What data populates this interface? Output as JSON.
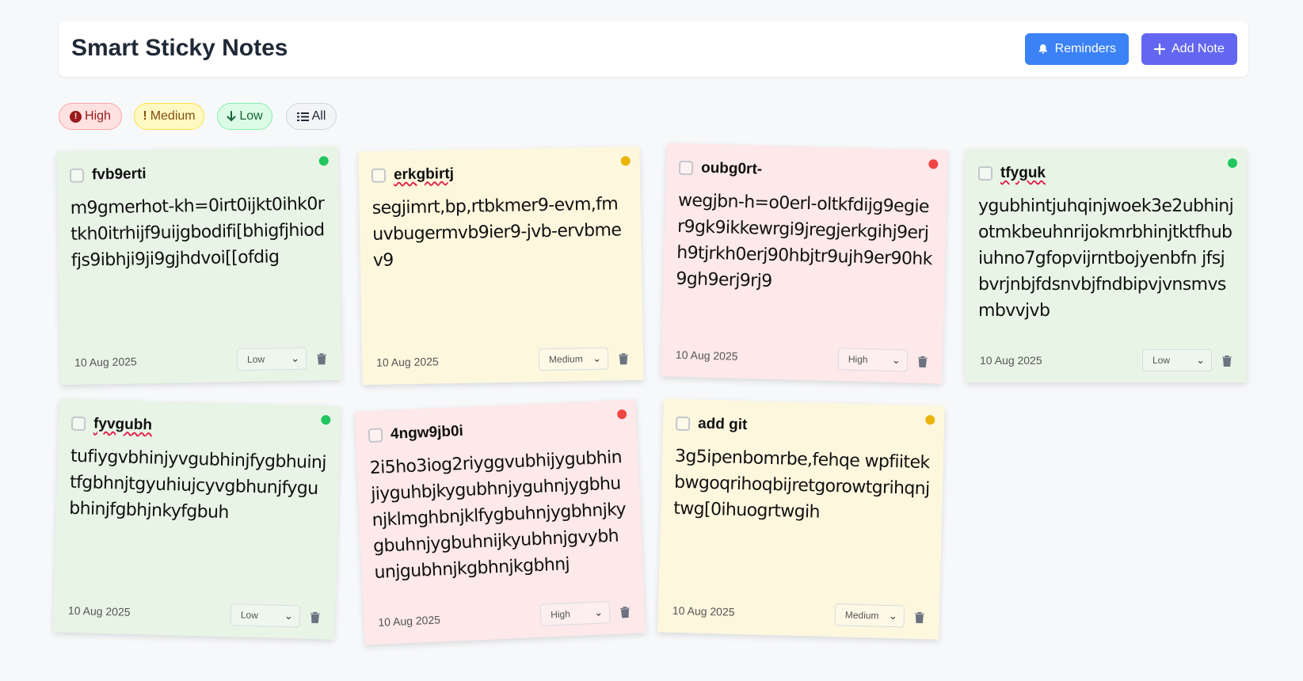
{
  "header": {
    "title": "Smart Sticky Notes",
    "reminders_label": "Reminders",
    "add_note_label": "Add Note",
    "reminders_icon": "bell-icon",
    "add_icon": "plus-icon",
    "reminders_color": "#3b82f6",
    "add_color": "#6366f1"
  },
  "filters": {
    "high": "High",
    "medium": "Medium",
    "low": "Low",
    "all": "All"
  },
  "colors": {
    "high_dot": "#ef4444",
    "medium_dot": "#eab308",
    "low_dot": "#22c55e"
  },
  "notes": [
    {
      "title": "fvb9erti",
      "body": "m9gmerhot-kh=0irt0ijkt0ihk0rtkh0itrhijf9uijgbodifi[bhigfjhiodfjs9ibhji9ji9gjhdvoi[[ofdig",
      "date": "10 Aug 2025",
      "priority": "Low"
    },
    {
      "title": "erkgbirtj",
      "body": "segjimrt,bp,rtbkmer9-evm,fmuvbugermvb9ier9-jvb-ervbmev9",
      "date": "10 Aug 2025",
      "priority": "Medium"
    },
    {
      "title": "oubg0rt-",
      "body": "wegjbn-h=o0erl-oltkfdijg9egier9gk9ikkewrgi9jregjerkgihj9erjh9tjrkh0erj90hbjtr9ujh9er90hk9gh9erj9rj9",
      "date": "10 Aug 2025",
      "priority": "High"
    },
    {
      "title": "tfyguk",
      "body": "ygubhintjuhqinjwoek3e2ubhinjotmkbeuhnrijokmrbhinjtktfhubiuhno7gfopvijrntbojyenbfn jfsjbvrjnbjfdsnvbjfndbipvjvnsmvsmbvvjvb",
      "date": "10 Aug 2025",
      "priority": "Low"
    },
    {
      "title": "fyvgubh",
      "body": "tufiygvbhinjyvgubhinjfygbhuinjtfgbhnjtgyuhiujcyvgbhunjfygubhinjfgbhjnkyfgbuh",
      "date": "10 Aug 2025",
      "priority": "Low"
    },
    {
      "title": "4ngw9jb0i",
      "body": "2i5ho3iog2riyggvubhijygubhinjiyguhbjkygubhnjyguhnjygbhunjklmghbnjklfygbuhnjygbhnjkygbuhnjygbuhnijkyubhnjgvybhunjgubhnjkgbhnjkgbhnj",
      "date": "10 Aug 2025",
      "priority": "High"
    },
    {
      "title": "add git",
      "body": "3g5ipenbomrbe,fehqe wpfiitekbwgoqrihoqbijretgorowtgrihqnjtwg[0ihuogrtwgih",
      "date": "10 Aug 2025",
      "priority": "Medium"
    }
  ]
}
